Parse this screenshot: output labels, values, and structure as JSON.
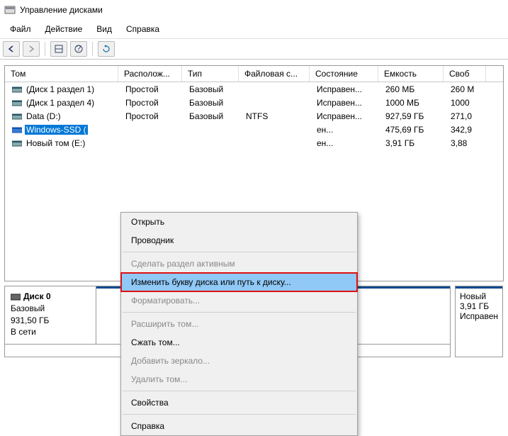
{
  "window": {
    "title": "Управление дисками"
  },
  "menu": {
    "file": "Файл",
    "action": "Действие",
    "view": "Вид",
    "help": "Справка"
  },
  "table": {
    "headers": {
      "tom": "Том",
      "loc": "Располож...",
      "type": "Тип",
      "fs": "Файловая с...",
      "state": "Состояние",
      "cap": "Емкость",
      "free": "Своб"
    },
    "rows": [
      {
        "name": "(Диск 1 раздел 1)",
        "loc": "Простой",
        "type": "Базовый",
        "fs": "",
        "state": "Исправен...",
        "cap": "260 МБ",
        "free": "260 М"
      },
      {
        "name": "(Диск 1 раздел 4)",
        "loc": "Простой",
        "type": "Базовый",
        "fs": "",
        "state": "Исправен...",
        "cap": "1000 МБ",
        "free": "1000"
      },
      {
        "name": "Data (D:)",
        "loc": "Простой",
        "type": "Базовый",
        "fs": "NTFS",
        "state": "Исправен...",
        "cap": "927,59 ГБ",
        "free": "271,0"
      },
      {
        "name": "Windows-SSD (",
        "loc": "",
        "type": "",
        "fs": "",
        "state": "ен...",
        "cap": "475,69 ГБ",
        "free": "342,9"
      },
      {
        "name": "Новый том (E:)",
        "loc": "",
        "type": "",
        "fs": "",
        "state": "ен...",
        "cap": "3,91 ГБ",
        "free": "3,88"
      }
    ]
  },
  "context": {
    "open": "Открыть",
    "explorer": "Проводник",
    "make_active": "Сделать раздел активным",
    "change_letter": "Изменить букву диска или путь к диску...",
    "format": "Форматировать...",
    "extend": "Расширить том...",
    "shrink": "Сжать том...",
    "add_mirror": "Добавить зеркало...",
    "delete": "Удалить том...",
    "props": "Свойства",
    "help": "Справка"
  },
  "bottom": {
    "disk0": {
      "name": "Диск 0",
      "type": "Базовый",
      "size": "931,50 ГБ",
      "status": "В сети"
    },
    "part_right": {
      "name": "Новый",
      "size": "3,91 ГБ",
      "state": "Исправен"
    }
  }
}
